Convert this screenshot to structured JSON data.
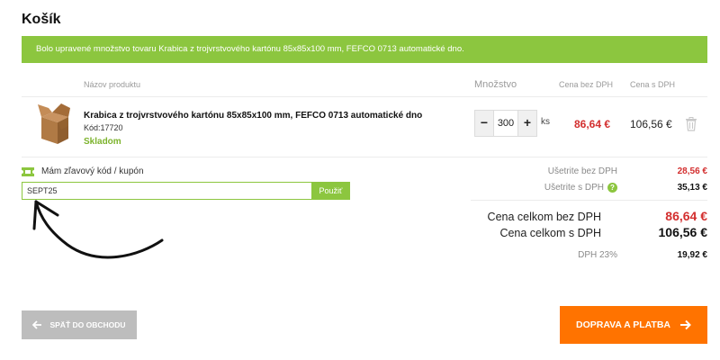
{
  "page": {
    "title": "Košík"
  },
  "notice": {
    "text": "Bolo upravené množstvo tovaru Krabica z trojvrstvového kartónu 85x85x100 mm, FEFCO 0713 automatické dno."
  },
  "table": {
    "headers": {
      "product": "Názov produktu",
      "quantity": "Množstvo",
      "price_ex_vat": "Cena bez DPH",
      "price_inc_vat": "Cena s DPH"
    },
    "rows": [
      {
        "name": "Krabica z trojvrstvového kartónu 85x85x100 mm, FEFCO 0713 automatické dno",
        "code": "Kód:17720",
        "stock": "Skladom",
        "quantity": "300",
        "unit": "ks",
        "price_ex_vat": "86,64 €",
        "price_inc_vat": "106,56 €",
        "minus_label": "−",
        "plus_label": "+"
      }
    ]
  },
  "coupon": {
    "label": "Mám zľavový kód / kupón",
    "value": "SEPT25",
    "button": "Použiť"
  },
  "summary": {
    "savings_ex_label": "Ušetrite bez DPH",
    "savings_ex_value": "28,56 €",
    "savings_inc_label": "Ušetrite s DPH",
    "savings_inc_value": "35,13 €",
    "info_icon": "?",
    "total_ex_label": "Cena celkom bez DPH",
    "total_ex_value": "86,64 €",
    "total_inc_label": "Cena celkom s DPH",
    "total_inc_value": "106,56 €",
    "vat_label": "DPH 23%",
    "vat_value": "19,92 €"
  },
  "actions": {
    "back_label": "SPÄŤ DO OBCHODU",
    "next_label": "DOPRAVA A PLATBA"
  },
  "colors": {
    "accent_green": "#8cc63f",
    "price_red": "#d32f2f",
    "cta_orange": "#ff7300",
    "back_gray": "#bdbdbd"
  },
  "icons": {
    "coupon": "ticket-icon",
    "delete": "trash-icon",
    "back": "arrow-left-icon",
    "next": "arrow-right-icon"
  }
}
